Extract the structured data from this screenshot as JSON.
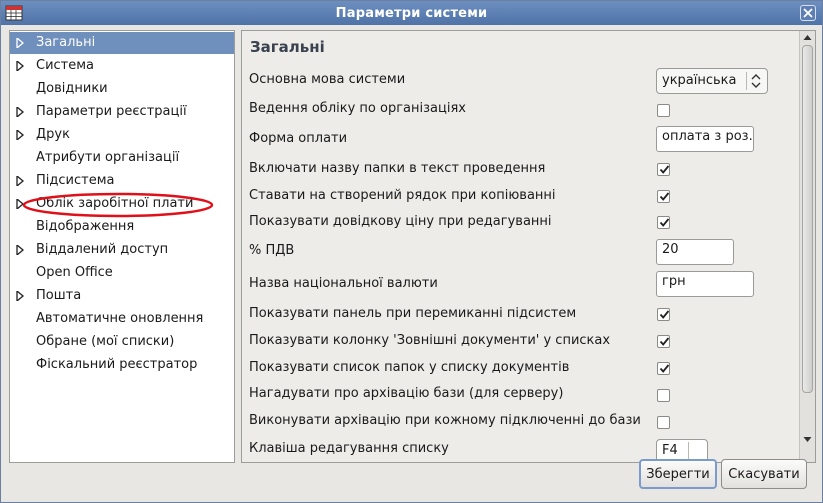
{
  "window": {
    "title": "Параметри системи"
  },
  "sidebar": {
    "items": [
      {
        "label": "Загальні",
        "expandable": true,
        "selected": true
      },
      {
        "label": "Система",
        "expandable": true
      },
      {
        "label": "Довідники",
        "expandable": false
      },
      {
        "label": "Параметри реєстрації",
        "expandable": true
      },
      {
        "label": "Друк",
        "expandable": true
      },
      {
        "label": "Атрибути організації",
        "expandable": false
      },
      {
        "label": "Підсистема",
        "expandable": true
      },
      {
        "label": "Облік заробітної плати",
        "expandable": true,
        "highlighted": true
      },
      {
        "label": "Відображення",
        "expandable": false
      },
      {
        "label": "Віддалений доступ",
        "expandable": true
      },
      {
        "label": "Open Office",
        "expandable": false
      },
      {
        "label": "Пошта",
        "expandable": true
      },
      {
        "label": "Автоматичне оновлення",
        "expandable": false
      },
      {
        "label": "Обране (мої списки)",
        "expandable": false
      },
      {
        "label": "Фіскальний реєстратор",
        "expandable": false
      }
    ]
  },
  "main": {
    "title": "Загальні",
    "rows": [
      {
        "label": "Основна мова системи",
        "control": "combo",
        "value": "українська"
      },
      {
        "label": "Ведення обліку по організаціях",
        "control": "checkbox",
        "checked": false
      },
      {
        "label": "Форма оплати",
        "control": "text",
        "value": "оплата з роз."
      },
      {
        "label": "Включати назву папки в текст проведення",
        "control": "checkbox",
        "checked": true
      },
      {
        "label": "Ставати на створений рядок при копіюванні",
        "control": "checkbox",
        "checked": true
      },
      {
        "label": "Показувати довідкову ціну при редагуванні",
        "control": "checkbox",
        "checked": true
      },
      {
        "label": "% ПДВ",
        "control": "text",
        "value": "20"
      },
      {
        "label": "Назва національної валюти",
        "control": "text",
        "value": "грн"
      },
      {
        "label": "Показувати панель при перемиканні підсистем",
        "control": "checkbox",
        "checked": true
      },
      {
        "label": "Показувати колонку 'Зовнішні документи' у списках",
        "control": "checkbox",
        "checked": true
      },
      {
        "label": "Показувати список папок у списку документів",
        "control": "checkbox",
        "checked": true
      },
      {
        "label": "Нагадувати про архівацію бази (для серверу)",
        "control": "checkbox",
        "checked": false
      },
      {
        "label": "Виконувати архівацію при кожному підключенні до бази",
        "control": "checkbox",
        "checked": false
      },
      {
        "label": "Клавіша редагування списку",
        "control": "stepper",
        "value": "F4"
      }
    ]
  },
  "buttons": {
    "save": "Зберегти",
    "cancel": "Скасувати"
  },
  "colors": {
    "titlebar": "#5a7db3",
    "selection": "#6f8fbd",
    "highlight_ring": "#e0101a"
  },
  "icons": {
    "app": "table-icon",
    "close": "close-icon",
    "expand": "triangle-right-icon",
    "check": "checkmark-icon"
  }
}
